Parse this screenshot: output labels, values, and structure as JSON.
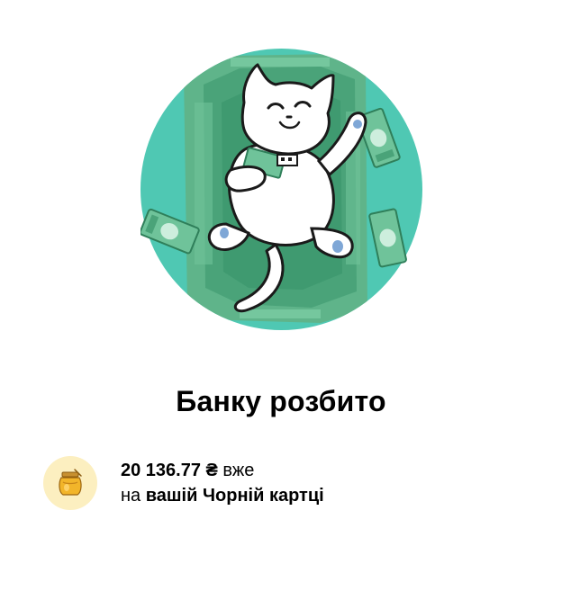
{
  "colors": {
    "hero_circle": "#4fc8b3",
    "money_green": "#5fb48a",
    "money_dark": "#2f7f5a",
    "icon_bg": "#fcefc0",
    "text": "#000000"
  },
  "hero": {
    "illustration": "cat-lying-on-money"
  },
  "title": "Банку розбито",
  "jar_info": {
    "icon": "honey-jar-icon",
    "amount": "20 136.77 ₴",
    "line1_suffix": " вже",
    "line2_prefix": "на ",
    "line2_emphasis": "вашій Чорній картці"
  }
}
